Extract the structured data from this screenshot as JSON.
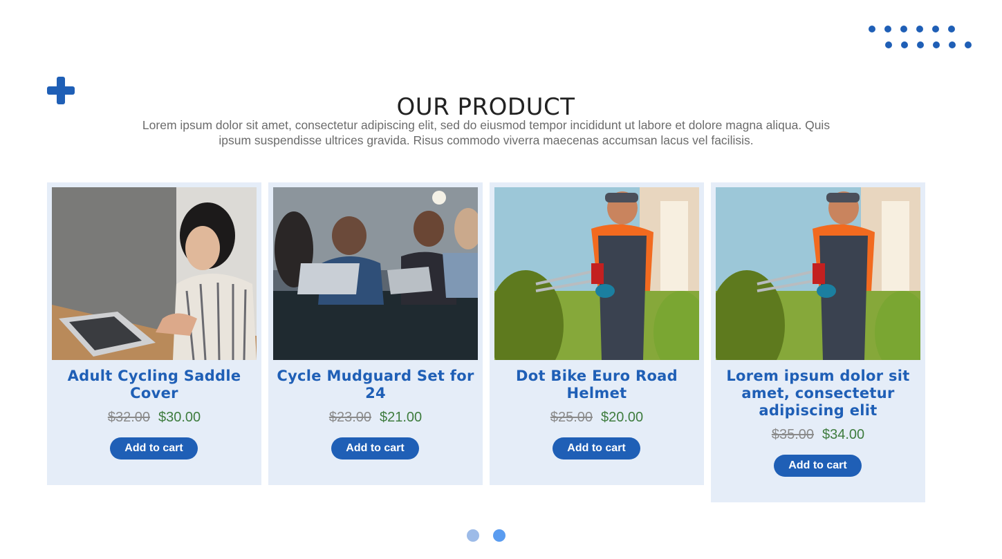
{
  "section": {
    "title": "OUR PRODUCT",
    "subtitle": "Lorem ipsum dolor sit amet, consectetur adipiscing elit, sed do eiusmod tempor incididunt ut labore et dolore magna aliqua. Quis ipsum suspendisse ultrices gravida. Risus commodo viverra maecenas accumsan lacus vel facilisis."
  },
  "colors": {
    "accent": "#1f5fb6",
    "card_bg": "#e5edf8",
    "sale_price": "#3e7c3e",
    "old_price": "#8a8a8a",
    "pager_inactive": "#9dbbe8",
    "pager_active": "#5a9cf0"
  },
  "products": [
    {
      "name": "Adult Cycling Saddle Cover",
      "old_price": "$32.00",
      "price": "$30.00",
      "button": "Add to cart",
      "image": "woman-laptop-photo"
    },
    {
      "name": "Cycle Mudguard Set for 24",
      "old_price": "$23.00",
      "price": "$21.00",
      "button": "Add to cart",
      "image": "team-meeting-photo"
    },
    {
      "name": "Dot Bike Euro Road Helmet",
      "old_price": "$25.00",
      "price": "$20.00",
      "button": "Add to cart",
      "image": "gardener-trimming-photo"
    },
    {
      "name": "Lorem ipsum dolor sit amet, consectetur adipiscing elit",
      "old_price": "$35.00",
      "price": "$34.00",
      "button": "Add to cart",
      "image": "gardener-trimming-photo"
    }
  ],
  "pager": {
    "pages": 2,
    "active": 2
  }
}
